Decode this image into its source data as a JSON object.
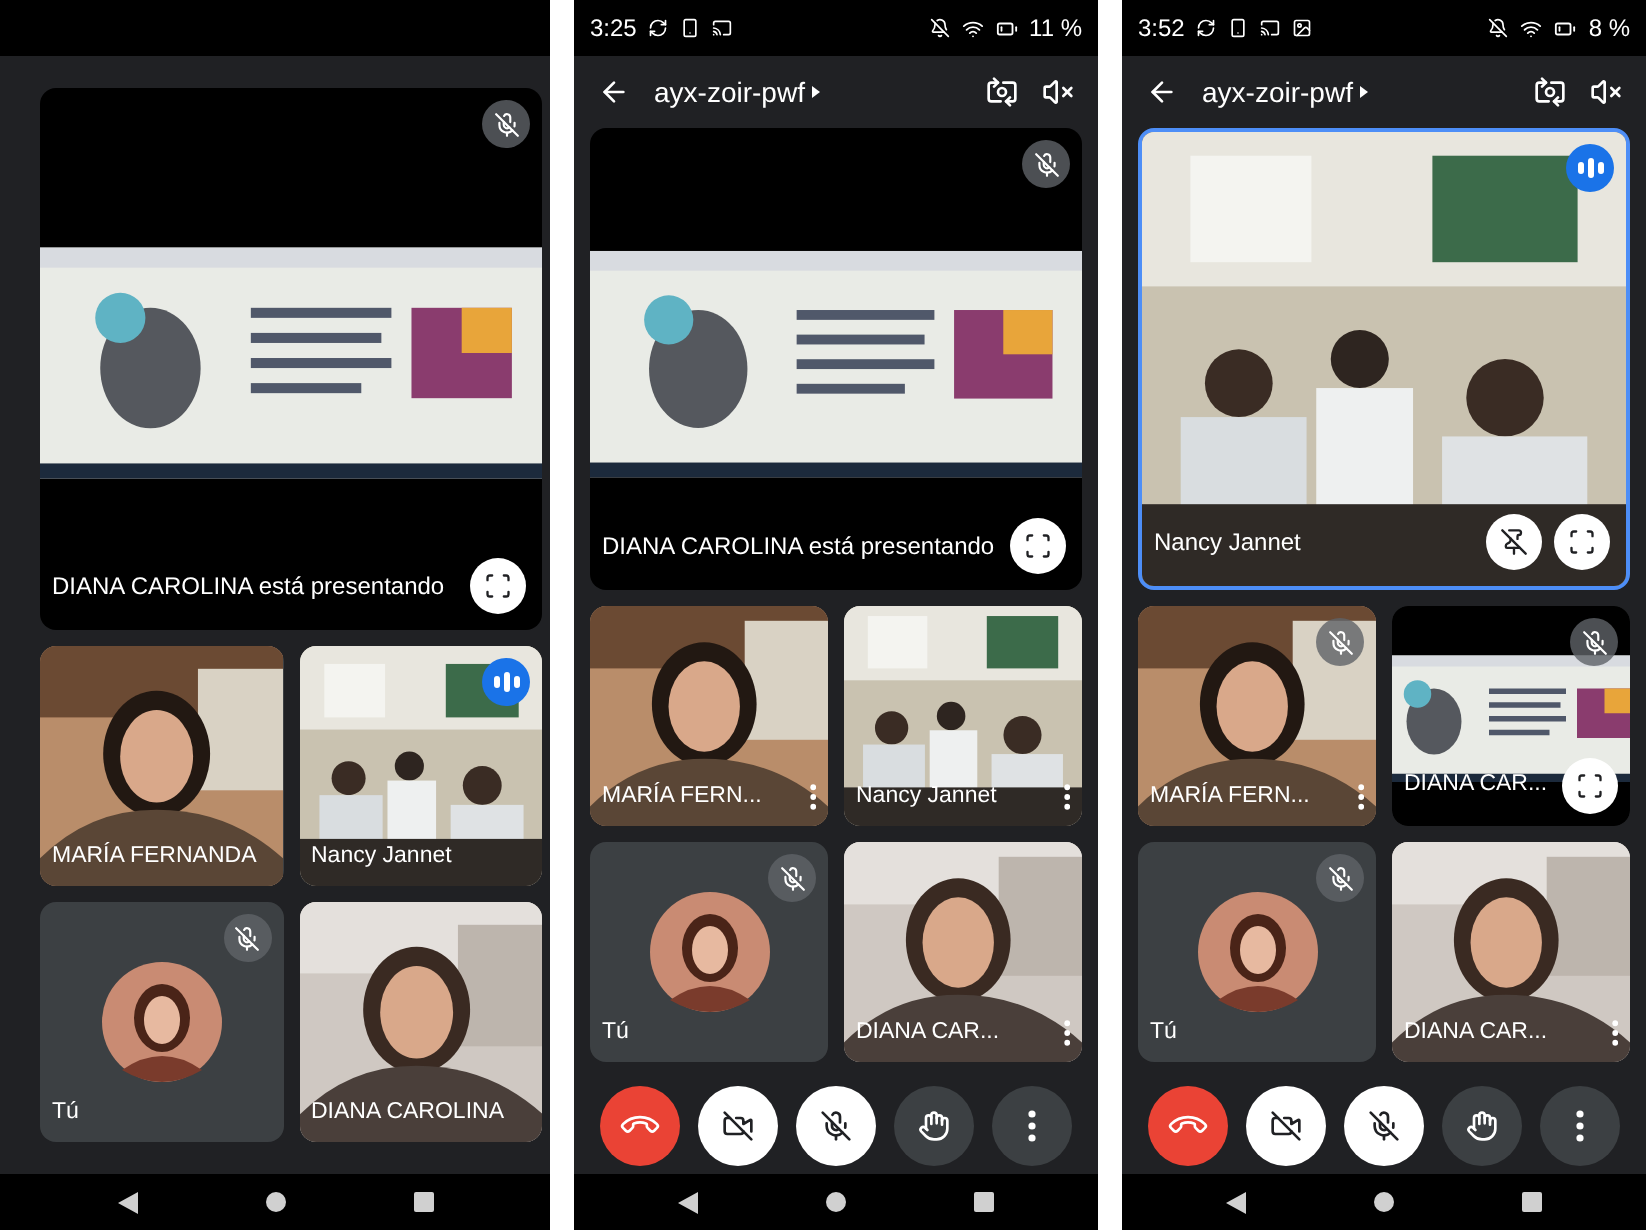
{
  "phones": [
    {
      "main": {
        "kind": "presentation",
        "caption": "DIANA CAROLINA está presentando",
        "muted": true,
        "speaking": false,
        "pinned": false
      },
      "tiles": [
        {
          "kind": "video",
          "name": "MARÍA FERNANDA",
          "muted": false,
          "speaking": false,
          "more": false,
          "fullscreen": false
        },
        {
          "kind": "video",
          "name": "Nancy Jannet",
          "muted": false,
          "speaking": true,
          "more": false,
          "fullscreen": false
        },
        {
          "name": "Tú",
          "muted": true,
          "speaking": false,
          "more": false,
          "fullscreen": false
        },
        {
          "kind": "video",
          "name": "DIANA CAROLINA",
          "muted": false,
          "speaking": false,
          "more": false,
          "fullscreen": false
        }
      ]
    },
    {
      "status_bar": {
        "time": "3:25",
        "battery": "11 %",
        "extra_icon": false
      },
      "header": {
        "title": "ayx-zoir-pwf"
      },
      "main": {
        "kind": "presentation",
        "caption": "DIANA CAROLINA está presentando",
        "muted": true,
        "speaking": false,
        "pinned": false
      },
      "tiles": [
        {
          "kind": "video",
          "name": "MARÍA FERN...",
          "muted": false,
          "speaking": false,
          "more": true,
          "fullscreen": false
        },
        {
          "kind": "video",
          "name": "Nancy Jannet",
          "muted": false,
          "speaking": false,
          "more": true,
          "fullscreen": false
        },
        {
          "name": "Tú",
          "muted": true,
          "speaking": false,
          "more": false,
          "fullscreen": false
        },
        {
          "kind": "video",
          "name": "DIANA CAR...",
          "muted": false,
          "speaking": false,
          "more": true,
          "fullscreen": false
        }
      ],
      "controls": [
        {
          "kind": "end"
        },
        {
          "kind": "camera"
        },
        {
          "kind": "mic"
        },
        {
          "kind": "hand"
        },
        {
          "kind": "more"
        }
      ]
    },
    {
      "status_bar": {
        "time": "3:52",
        "battery": "8 %",
        "extra_icon": true
      },
      "header": {
        "title": "ayx-zoir-pwf"
      },
      "main": {
        "kind": "video",
        "caption": "Nancy Jannet",
        "muted": false,
        "speaking": true,
        "pinned": true
      },
      "tiles": [
        {
          "kind": "video",
          "name": "MARÍA FERN...",
          "muted": true,
          "speaking": false,
          "more": true,
          "fullscreen": false
        },
        {
          "kind": "presentation",
          "name": "DIANA CAR...",
          "muted": true,
          "speaking": false,
          "more": false,
          "fullscreen": true
        },
        {
          "name": "Tú",
          "muted": true,
          "speaking": false,
          "more": false,
          "fullscreen": false
        },
        {
          "kind": "video",
          "name": "DIANA CAR...",
          "muted": false,
          "speaking": false,
          "more": true,
          "fullscreen": false
        }
      ],
      "controls": [
        {
          "kind": "end"
        },
        {
          "kind": "camera"
        },
        {
          "kind": "mic"
        },
        {
          "kind": "hand"
        },
        {
          "kind": "more"
        }
      ]
    }
  ]
}
